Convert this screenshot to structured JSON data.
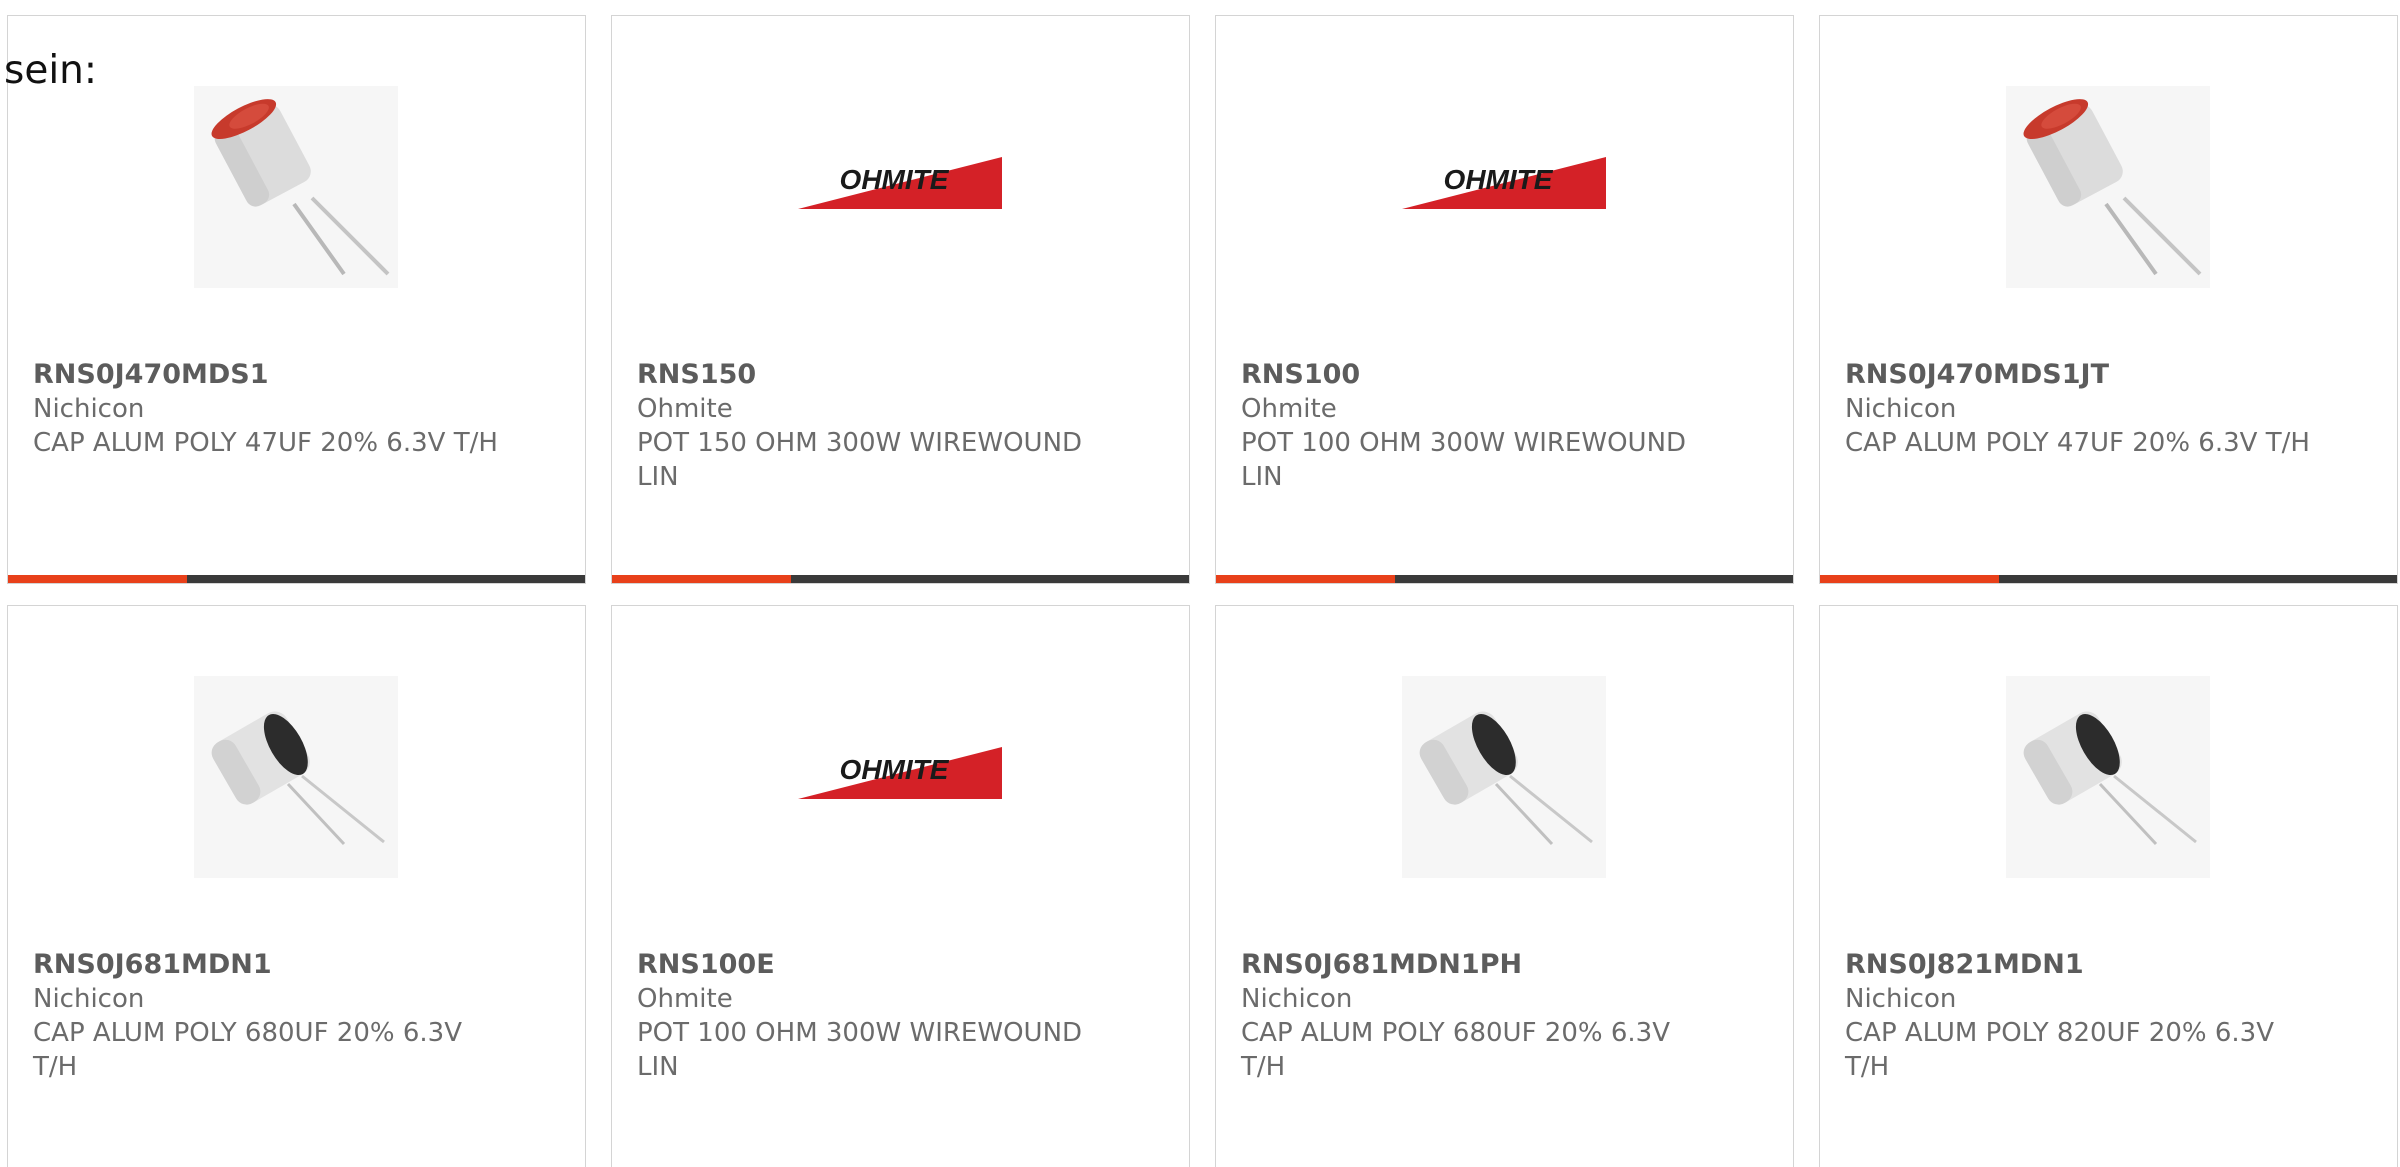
{
  "intro_text": "sein:",
  "accent_color": "#e8401a",
  "bar_color": "#3a3a3a",
  "cards": [
    {
      "part": "RNS0J470MDS1",
      "manufacturer": "Nichicon",
      "description": "CAP ALUM POLY 47UF 20% 6.3V T/H",
      "image": "capacitor-tall-photo",
      "progress": 0.31
    },
    {
      "part": "RNS150",
      "manufacturer": "Ohmite",
      "description": "POT 150 OHM 300W WIREWOUND LIN",
      "image": "ohmite-logo",
      "logo_text": "OHMITE",
      "progress": 0.31
    },
    {
      "part": "RNS100",
      "manufacturer": "Ohmite",
      "description": "POT 100 OHM 300W WIREWOUND LIN",
      "image": "ohmite-logo",
      "logo_text": "OHMITE",
      "progress": 0.31
    },
    {
      "part": "RNS0J470MDS1JT",
      "manufacturer": "Nichicon",
      "description": "CAP ALUM POLY 47UF 20% 6.3V T/H",
      "image": "capacitor-tall-photo",
      "progress": 0.31
    },
    {
      "part": "RNS0J681MDN1",
      "manufacturer": "Nichicon",
      "description": "CAP ALUM POLY 680UF 20% 6.3V T/H",
      "image": "capacitor-short-photo"
    },
    {
      "part": "RNS100E",
      "manufacturer": "Ohmite",
      "description": "POT 100 OHM 300W WIREWOUND LIN",
      "image": "ohmite-logo",
      "logo_text": "OHMITE"
    },
    {
      "part": "RNS0J681MDN1PH",
      "manufacturer": "Nichicon",
      "description": "CAP ALUM POLY 680UF 20% 6.3V T/H",
      "image": "capacitor-short-photo"
    },
    {
      "part": "RNS0J821MDN1",
      "manufacturer": "Nichicon",
      "description": "CAP ALUM POLY 820UF 20% 6.3V T/H",
      "image": "capacitor-short-photo"
    }
  ]
}
